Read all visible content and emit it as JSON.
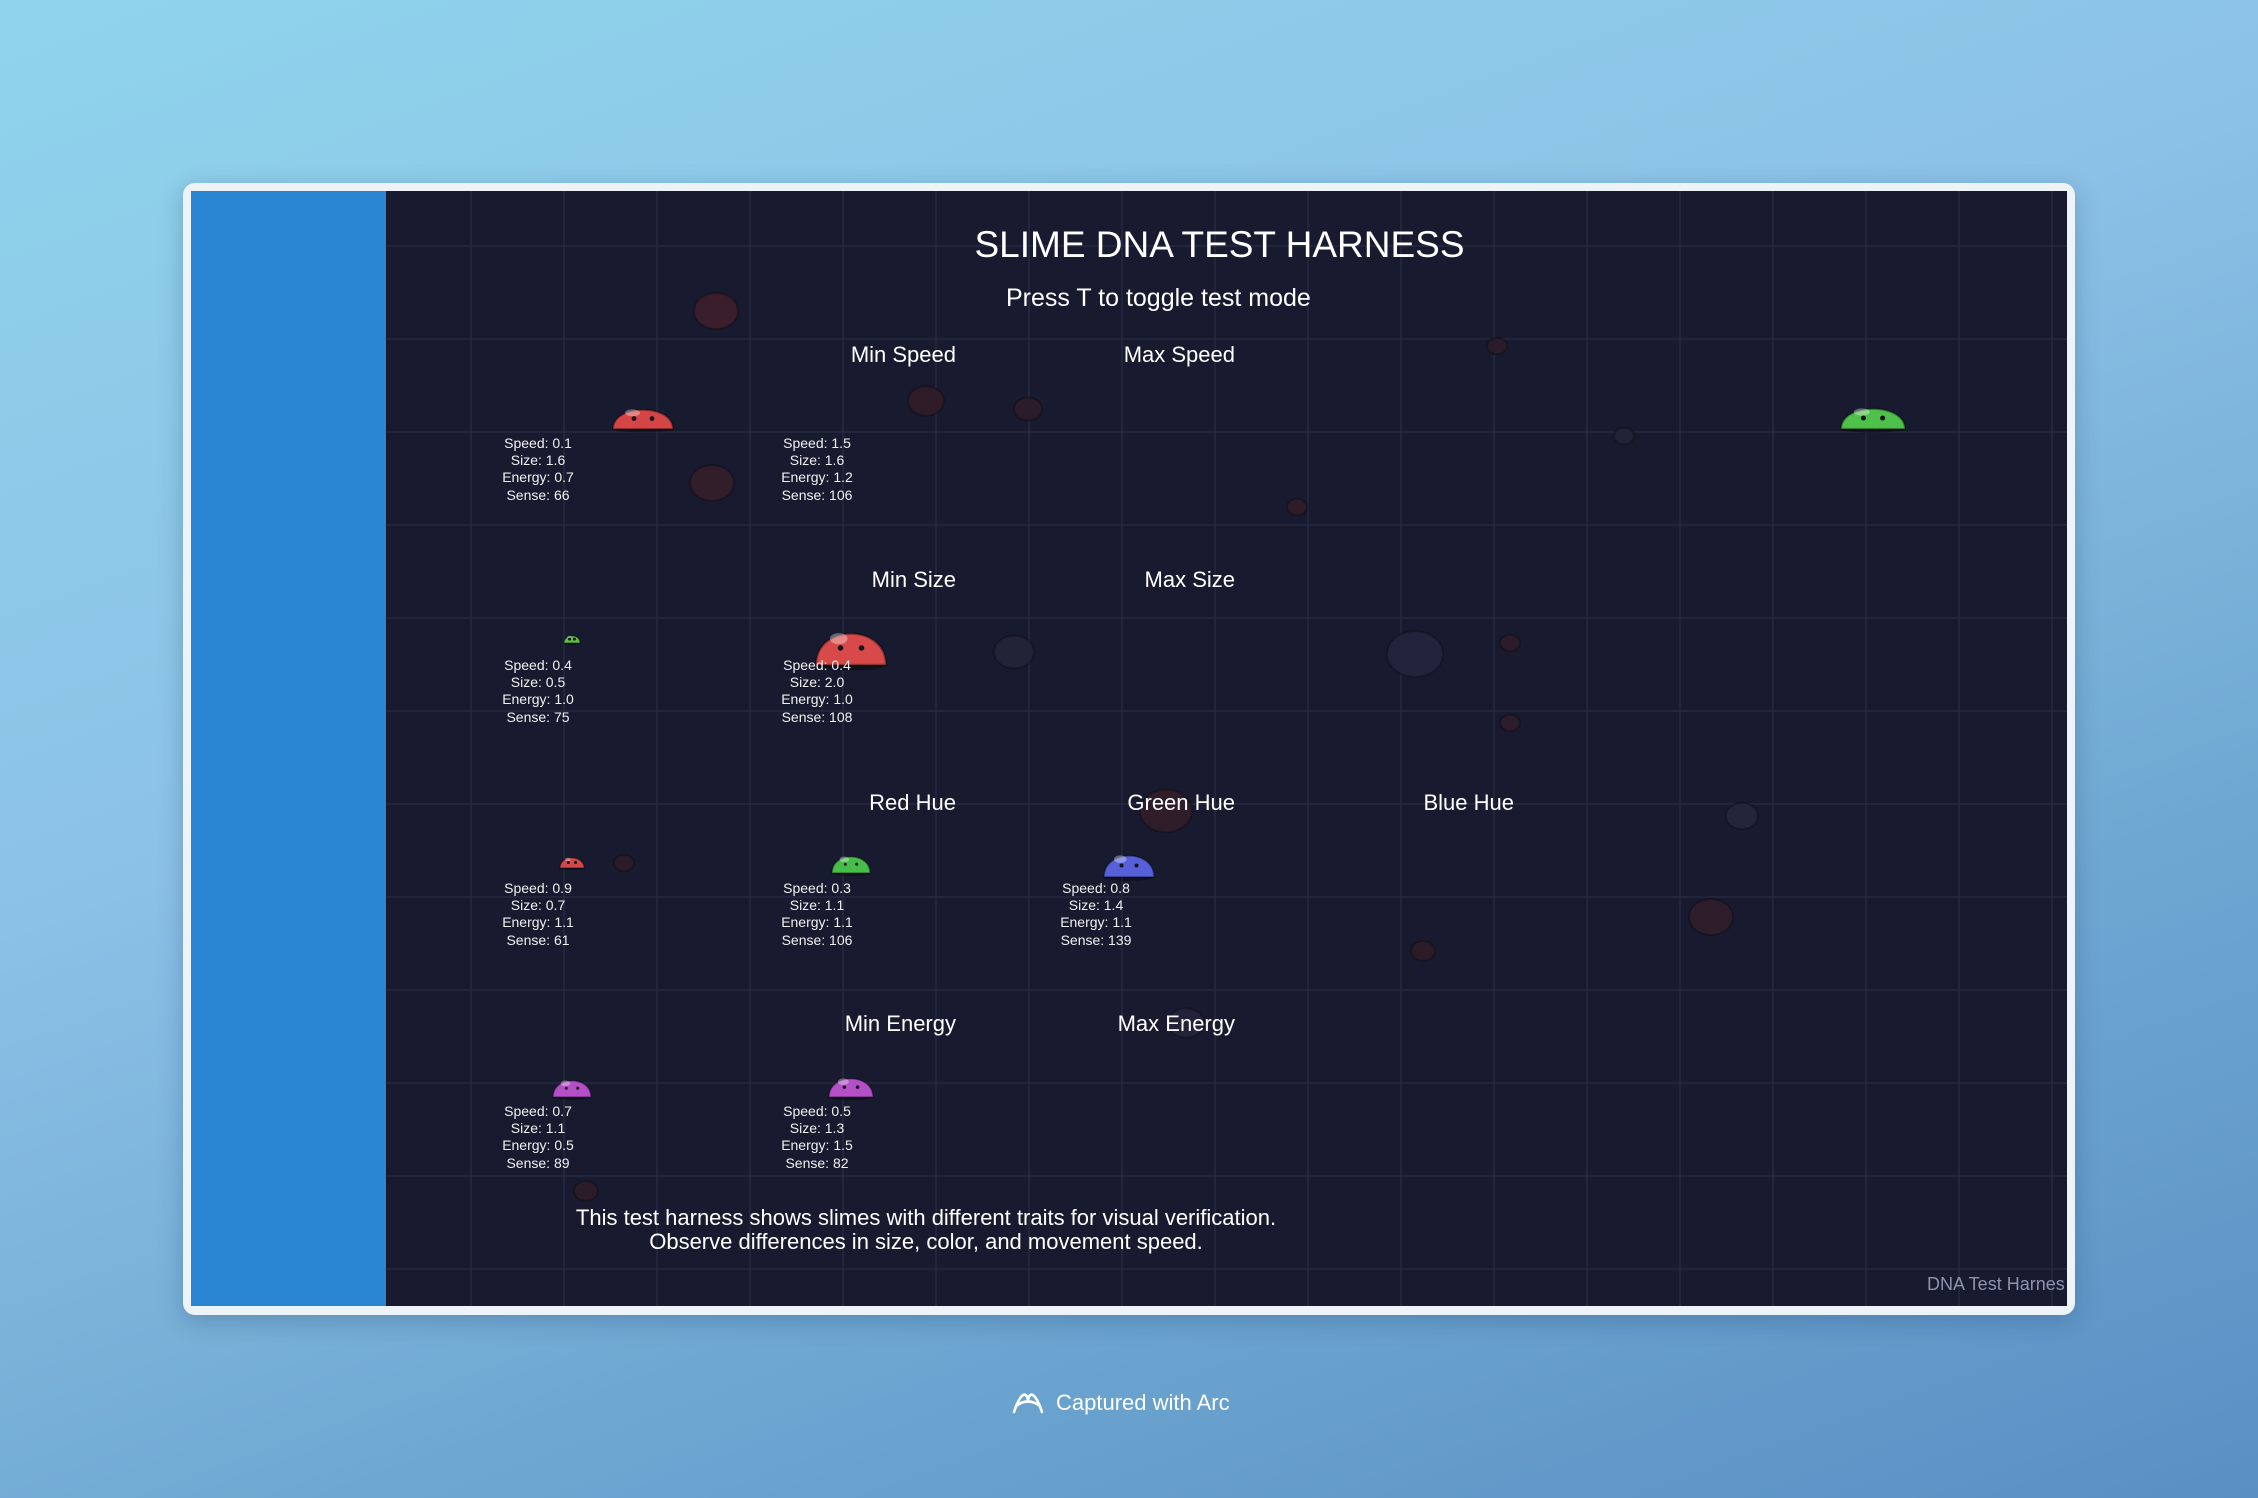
{
  "title": "SLIME DNA TEST HARNESS",
  "subtitle": "Press T to toggle test mode",
  "slimes": [
    {
      "label": "Min Speed",
      "speed": "Speed: 0.1",
      "size": "Size: 1.6",
      "energy": "Energy: 0.7",
      "sense": "Sense: 66",
      "color": "#d64545"
    },
    {
      "label": "Max Speed",
      "speed": "Speed: 1.5",
      "size": "Size: 1.6",
      "energy": "Energy: 1.2",
      "sense": "Sense: 106",
      "color": "#4fc04a"
    },
    {
      "label": "Min Size",
      "speed": "Speed: 0.4",
      "size": "Size: 0.5",
      "energy": "Energy: 1.0",
      "sense": "Sense: 75",
      "color": "#5cc045"
    },
    {
      "label": "Max Size",
      "speed": "Speed: 0.4",
      "size": "Size: 2.0",
      "energy": "Energy: 1.0",
      "sense": "Sense: 108",
      "color": "#d84a4a"
    },
    {
      "label": "Red Hue",
      "speed": "Speed: 0.9",
      "size": "Size: 0.7",
      "energy": "Energy: 1.1",
      "sense": "Sense: 61",
      "color": "#d24848"
    },
    {
      "label": "Green Hue",
      "speed": "Speed: 0.3",
      "size": "Size: 1.1",
      "energy": "Energy: 1.1",
      "sense": "Sense: 106",
      "color": "#48be4a"
    },
    {
      "label": "Blue Hue",
      "speed": "Speed: 0.8",
      "size": "Size: 1.4",
      "energy": "Energy: 1.1",
      "sense": "Sense: 139",
      "color": "#5660d8"
    },
    {
      "label": "Min Energy",
      "speed": "Speed: 0.7",
      "size": "Size: 1.1",
      "energy": "Energy: 0.5",
      "sense": "Sense: 89",
      "color": "#b44fc8"
    },
    {
      "label": "Max Energy",
      "speed": "Speed: 0.5",
      "size": "Size: 1.3",
      "energy": "Energy: 1.5",
      "sense": "Sense: 82",
      "color": "#b44fc8"
    }
  ],
  "footer_line1": "This test harness shows slimes with different traits for visual verification.",
  "footer_line2": "Observe differences in size, color, and movement speed.",
  "corner_label": "DNA Test Harnes",
  "capture_label": "Captured with Arc",
  "colors": {
    "sidebar": "#2a86d2",
    "canvas": "#181b2f",
    "grid": "#262a42"
  }
}
